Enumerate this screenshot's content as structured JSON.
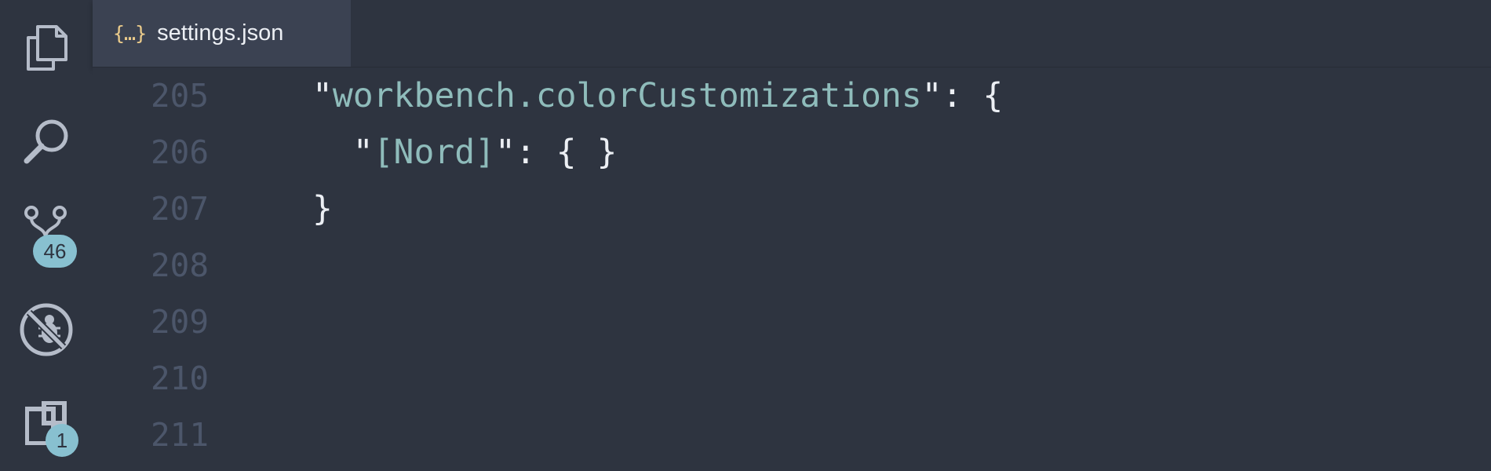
{
  "tab": {
    "icon": "{…}",
    "label": "settings.json"
  },
  "activity_bar": {
    "items": [
      {
        "name": "explorer",
        "icon": "files-icon"
      },
      {
        "name": "search",
        "icon": "search-icon"
      },
      {
        "name": "source-control",
        "icon": "source-control-icon",
        "badge": "46"
      },
      {
        "name": "debug",
        "icon": "no-bug-icon"
      },
      {
        "name": "extensions",
        "icon": "extensions-icon",
        "badge": "1"
      }
    ]
  },
  "editor": {
    "lines": [
      {
        "number": "205",
        "indent": "",
        "open_quote": "\"",
        "key": "workbench.colorCustomizations",
        "rest": "\": {"
      },
      {
        "number": "206",
        "indent": "  ",
        "open_quote": "\"",
        "key": "[Nord]",
        "rest": "\": { }"
      },
      {
        "number": "207",
        "indent": "",
        "open_quote": "",
        "key": "",
        "rest": "}"
      },
      {
        "number": "208",
        "indent": "",
        "open_quote": "",
        "key": "",
        "rest": ""
      },
      {
        "number": "209",
        "indent": "",
        "open_quote": "",
        "key": "",
        "rest": ""
      },
      {
        "number": "210",
        "indent": "",
        "open_quote": "",
        "key": "",
        "rest": ""
      },
      {
        "number": "211",
        "indent": "",
        "open_quote": "",
        "key": "",
        "rest": ""
      }
    ]
  },
  "colors": {
    "background": "#2e3440",
    "tab_active": "#3b4252",
    "line_number": "#4c566a",
    "json_key": "#8fbcbb",
    "punctuation": "#eceff4",
    "badge": "#88c0d0",
    "icon": "#d8dee9"
  }
}
